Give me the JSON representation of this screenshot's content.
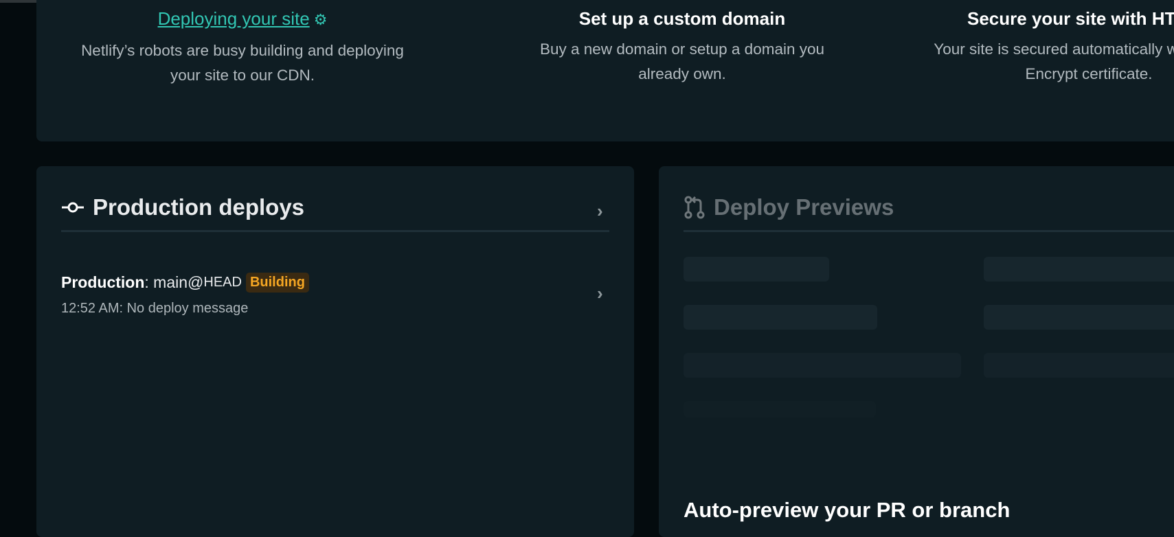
{
  "steps": [
    {
      "title": "Deploying your site",
      "desc_line1": "Netlify’s robots are busy building and deploying",
      "desc_line2": "your site to our CDN."
    },
    {
      "title": "Set up a custom domain",
      "desc_line1": "Buy a new domain or setup a domain you",
      "desc_line2": "already own."
    },
    {
      "title": "Secure your site with HTTPS",
      "desc_line1": "Your site is secured automatically with a Let’s",
      "desc_line2": "Encrypt certificate."
    }
  ],
  "production": {
    "title": "Production deploys",
    "deploy": {
      "context": "Production",
      "separator": ":",
      "ref": "main@",
      "head": "HEAD",
      "status": "Building",
      "message": "12:52 AM: No deploy message"
    }
  },
  "previews": {
    "title": "Deploy Previews",
    "subtitle": "Auto-preview your PR or branch"
  },
  "colors": {
    "accent": "#32c6b3",
    "building": "#f5a623",
    "card": "#0f1d23",
    "bg": "#040b0e"
  }
}
